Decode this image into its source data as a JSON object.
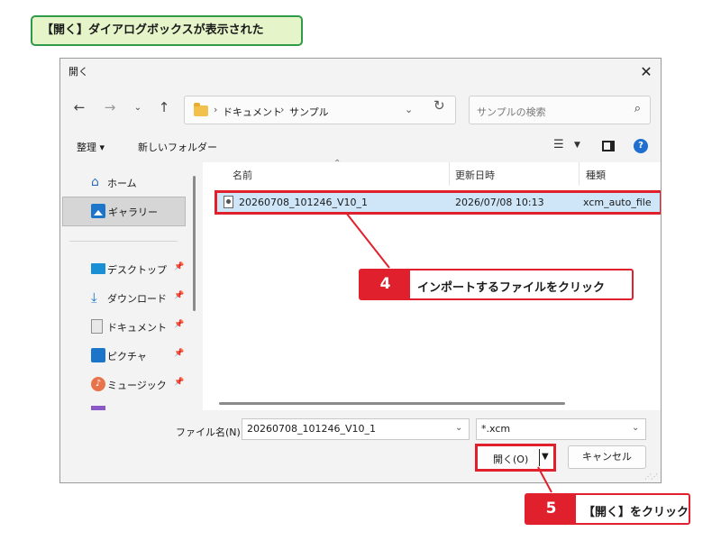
{
  "banner": {
    "text": "【開く】ダイアログボックスが表示された"
  },
  "dialog": {
    "title": "開く",
    "close_icon": "close-icon",
    "nav": {
      "back_icon": "arrow-left-icon",
      "forward_icon": "arrow-right-icon",
      "recent_icon": "chevron-down-icon",
      "up_icon": "arrow-up-icon"
    },
    "address": {
      "crumbs": [
        "ドキュメント",
        "サンプル"
      ],
      "separator": "›"
    },
    "search": {
      "placeholder": "サンプルの検索"
    },
    "toolbar": {
      "organize_label": "整理 ▾",
      "new_folder_label": "新しいフォルダー"
    },
    "sidebar": {
      "items": [
        {
          "label": "ホーム",
          "icon": "home-icon",
          "selected": false,
          "pinned": false
        },
        {
          "label": "ギャラリー",
          "icon": "gallery-icon",
          "selected": true,
          "pinned": false
        },
        {
          "label": "デスクトップ",
          "icon": "desktop-icon",
          "selected": false,
          "pinned": true
        },
        {
          "label": "ダウンロード",
          "icon": "download-icon",
          "selected": false,
          "pinned": true
        },
        {
          "label": "ドキュメント",
          "icon": "document-icon",
          "selected": false,
          "pinned": true
        },
        {
          "label": "ピクチャ",
          "icon": "pictures-icon",
          "selected": false,
          "pinned": true
        },
        {
          "label": "ミュージック",
          "icon": "music-icon",
          "selected": false,
          "pinned": true
        }
      ]
    },
    "files": {
      "columns": [
        "名前",
        "更新日時",
        "種類"
      ],
      "rows": [
        {
          "name": "20260708_101246_V10_1",
          "modified": "2026/07/08 10:13",
          "type": "xcm_auto_file",
          "selected": true
        }
      ]
    },
    "footer": {
      "filename_label": "ファイル名(N):",
      "filename_value": "20260708_101246_V10_1",
      "filetype_value": "*.xcm",
      "open_label": "開く(O)",
      "cancel_label": "キャンセル"
    }
  },
  "callouts": [
    {
      "number": "4",
      "text": "インポートするファイルをクリック"
    },
    {
      "number": "5",
      "text": "【開く】をクリック"
    }
  ],
  "colors": {
    "highlight": "#e0202c",
    "banner_border": "#2f9a47",
    "banner_fill": "#e6f5c9",
    "selection": "#cfe6f8",
    "accent": "#1d75c9"
  }
}
